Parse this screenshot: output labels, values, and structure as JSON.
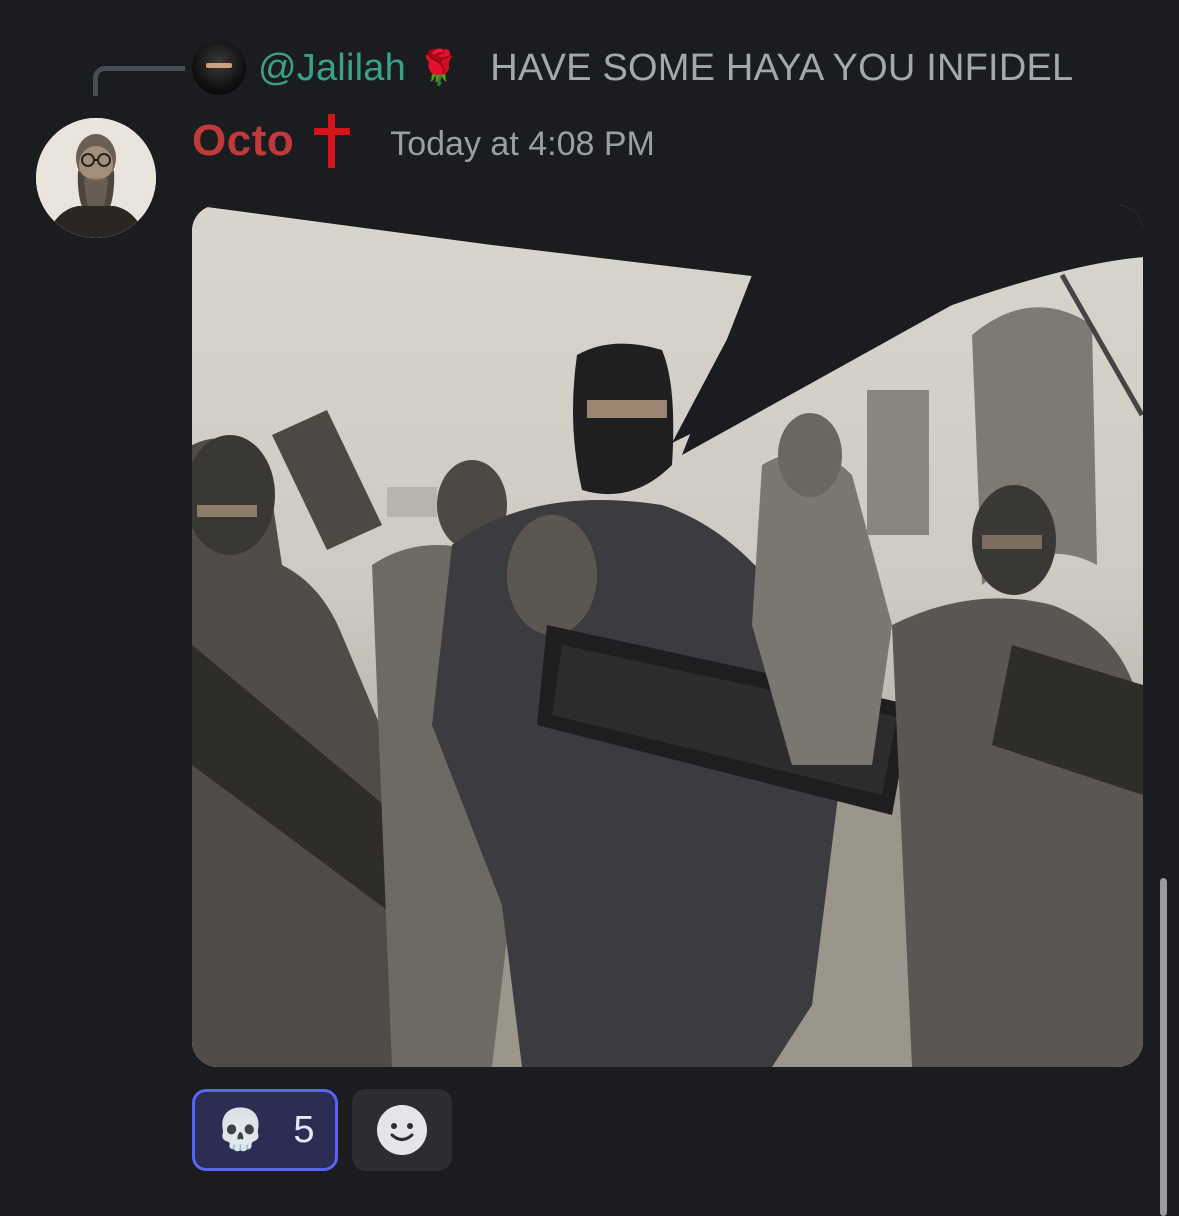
{
  "reply": {
    "mention": "@Jalilah",
    "name_emoji": "🌹",
    "text": "HAVE SOME HAYA YOU INFIDEL"
  },
  "message": {
    "author": "Octo",
    "timestamp": "Today at 4:08 PM",
    "attachment_alt": "illustration of masked men holding keyboards"
  },
  "reactions": [
    {
      "emoji": "💀",
      "count": "5",
      "selected": true
    }
  ],
  "colors": {
    "background": "#1b1c20",
    "author_name": "#c0393b",
    "reply_name": "#3aa088",
    "reaction_border": "#5865f2",
    "reaction_bg": "#2b2e52"
  },
  "icons": [
    "reply-spine",
    "red-cross-icon",
    "skull-icon",
    "add-reaction-icon"
  ]
}
